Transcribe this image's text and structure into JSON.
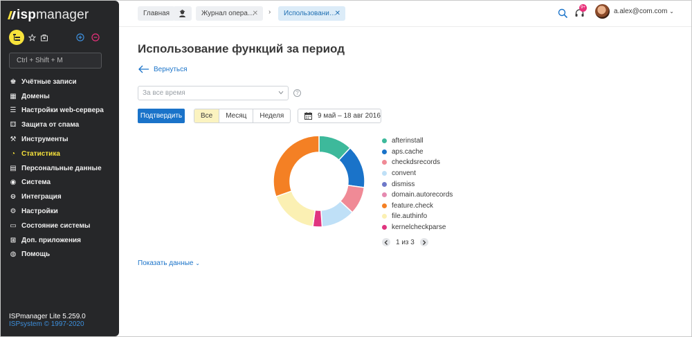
{
  "app": {
    "logo_bold": "isp",
    "logo_rest": "manager"
  },
  "sidebar": {
    "search_placeholder": "Ctrl + Shift + M",
    "items": [
      {
        "label": "Учётные записи",
        "icon": "users-icon"
      },
      {
        "label": "Домены",
        "icon": "domains-icon"
      },
      {
        "label": "Настройки web-сервера",
        "icon": "webserver-settings-icon"
      },
      {
        "label": "Защита от спама",
        "icon": "spam-protection-icon"
      },
      {
        "label": "Инструменты",
        "icon": "tools-icon"
      },
      {
        "label": "Статистика",
        "icon": "statistics-icon",
        "active": true
      },
      {
        "label": "Персональные данные",
        "icon": "personal-data-icon"
      },
      {
        "label": "Система",
        "icon": "system-icon"
      },
      {
        "label": "Интеграция",
        "icon": "integration-icon"
      },
      {
        "label": "Настройки",
        "icon": "settings-icon"
      },
      {
        "label": "Состояние системы",
        "icon": "monitor-icon"
      },
      {
        "label": "Доп. приложения",
        "icon": "apps-icon"
      },
      {
        "label": "Помощь",
        "icon": "help-icon"
      }
    ],
    "version": "ISPmanager Lite 5.259.0",
    "copyright": "ISPsystem © 1997-2020"
  },
  "topbar": {
    "crumbs": [
      "Главная",
      "Журнал опера…",
      "Использовани…"
    ],
    "separator": "›",
    "close_glyph": "✕",
    "notifications_count": "9+",
    "user_email": "a.alex@com.com"
  },
  "page": {
    "title": "Использование функций за период",
    "back_label": "Вернуться",
    "period_select": "За все время",
    "help_glyph": "?",
    "confirm_label": "Подтвердить",
    "period_tabs": [
      "Все",
      "Месяц",
      "Неделя"
    ],
    "active_tab": 0,
    "date_range": "9 май – 18 авг 2016",
    "pager_text": "1 из 3",
    "show_data_label": "Показать данные"
  },
  "colors": {
    "accent": "#1a73c9",
    "sidebar_bg": "#262729",
    "active_nav": "#f6e23b"
  },
  "chart_data": {
    "type": "pie",
    "style": "donut",
    "legend_position": "right",
    "categories": [
      "afterinstall",
      "aps.cache",
      "checkdsrecords",
      "convent",
      "dismiss",
      "domain.autorecords",
      "feature.check",
      "file.authinfo",
      "kernelcheckparse"
    ],
    "colors": [
      "#3db99b",
      "#1a73c9",
      "#f08a96",
      "#bfe0f7",
      "#6e79c9",
      "#e58ab0",
      "#f48024",
      "#fbf0b3",
      "#e0357f"
    ],
    "values": [
      11,
      14,
      9,
      11,
      0,
      0,
      28,
      16,
      3,
      8
    ],
    "note_series": []
  }
}
